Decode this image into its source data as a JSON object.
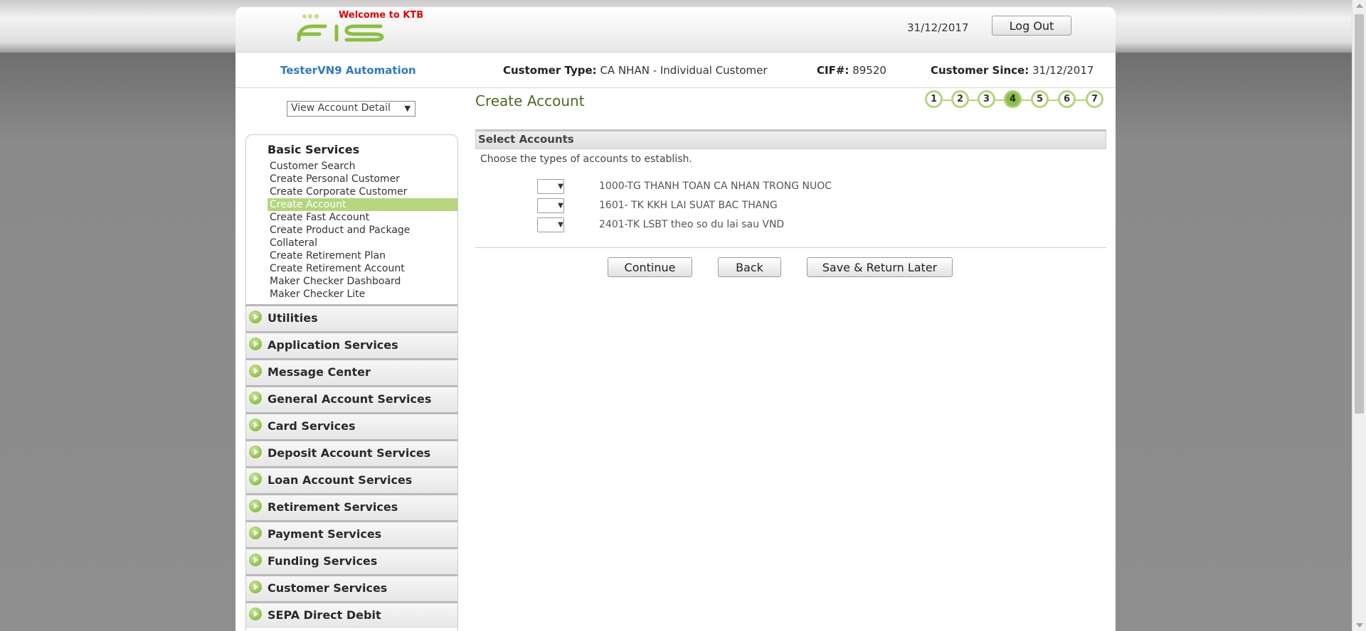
{
  "header": {
    "welcome": "Welcome to KTB",
    "date": "31/12/2017",
    "logout_label": "Log Out"
  },
  "customer": {
    "user": "TesterVN9 Automation",
    "type_label": "Customer Type:",
    "type_value": "CA NHAN - Individual Customer",
    "cif_label": "CIF#:",
    "cif_value": "89520",
    "since_label": "Customer Since:",
    "since_value": "31/12/2017"
  },
  "view_select": {
    "value": "View Account Detail"
  },
  "sidebar": {
    "basic_title": "Basic Services",
    "basic_items": [
      "Customer Search",
      "Create Personal Customer",
      "Create Corporate Customer",
      "Create Account",
      "Create Fast Account",
      "Create Product and Package",
      "Collateral",
      "Create Retirement Plan",
      "Create Retirement Account",
      "Maker Checker Dashboard",
      "Maker Checker Lite"
    ],
    "active_item": "Create Account",
    "sections": [
      "Utilities",
      "Application Services",
      "Message Center",
      "General Account Services",
      "Card Services",
      "Deposit Account Services",
      "Loan Account Services",
      "Retirement Services",
      "Payment Services",
      "Funding Services",
      "Customer Services",
      "SEPA Direct Debit"
    ]
  },
  "main": {
    "title": "Create Account",
    "steps": [
      "1",
      "2",
      "3",
      "4",
      "5",
      "6",
      "7"
    ],
    "current_step": "4",
    "section_header": "Select Accounts",
    "instruction": "Choose the types of accounts to establish.",
    "accounts": [
      {
        "label": "1000-TG THANH TOAN CA NHAN TRONG NUOC",
        "value": ""
      },
      {
        "label": "1601- TK KKH LAI SUAT BAC THANG",
        "value": ""
      },
      {
        "label": "2401-TK LSBT theo so du lai sau VND",
        "value": ""
      }
    ],
    "buttons": {
      "continue": "Continue",
      "back": "Back",
      "save_return": "Save & Return Later"
    }
  },
  "colors": {
    "accent_green": "#b5d67d",
    "title_green": "#4c6a1f",
    "user_blue": "#2f7bbf",
    "welcome_red": "#e30000"
  }
}
